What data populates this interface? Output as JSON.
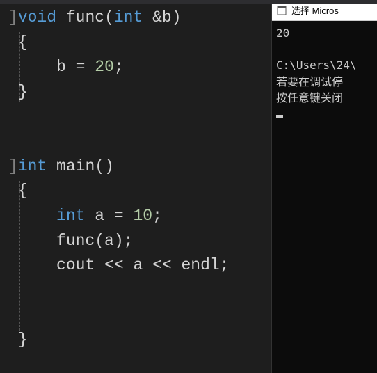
{
  "editor": {
    "lines": {
      "l1_void": "void",
      "l1_name": "func",
      "l1_int": "int",
      "l1_amp": "&",
      "l1_param": "b",
      "l2_brace": "{",
      "l3_b": "b",
      "l3_eq": "=",
      "l3_val": "20",
      "l3_semi": ";",
      "l4_brace": "}",
      "l6_int": "int",
      "l6_name": "main",
      "l7_brace": "{",
      "l8_int": "int",
      "l8_a": "a",
      "l8_eq": "=",
      "l8_val": "10",
      "l8_semi": ";",
      "l9_func": "func",
      "l9_a": "a",
      "l9_semi": ";",
      "l10_cout": "cout",
      "l10_a": "a",
      "l10_endl": "endl",
      "l10_semi": ";",
      "l12_brace": "}"
    }
  },
  "console": {
    "title": "选择 Micros",
    "output": "20",
    "path": "C:\\Users\\24\\",
    "line1": "若要在调试停",
    "line2": "按任意键关闭"
  }
}
